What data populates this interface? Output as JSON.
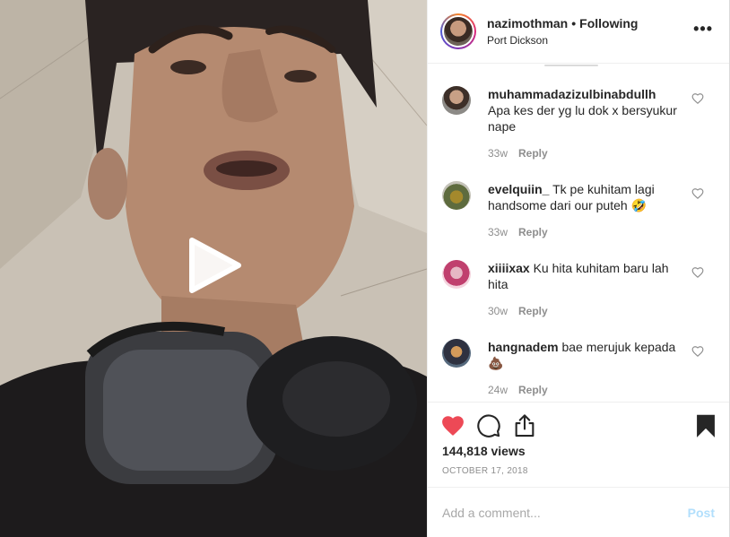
{
  "post": {
    "username": "nazimothman",
    "separator": "•",
    "follow_status": "Following",
    "location": "Port Dickson",
    "more_icon": "more-dots-icon",
    "more_label": "•••"
  },
  "media": {
    "type": "video",
    "play_icon": "play-icon"
  },
  "comments": [
    {
      "username": "muhammadazizulbinabdullh",
      "text": "Apa kes der yg lu dok x bersyukur nape",
      "age": "33w",
      "reply_label": "Reply",
      "avatar_color": "#6b5a4a"
    },
    {
      "username": "evelquiin_",
      "text": "Tk pe kuhitam lagi handsome dari our puteh 🤣",
      "age": "33w",
      "reply_label": "Reply",
      "avatar_color": "#7a6a3a"
    },
    {
      "username": "xiiiixax",
      "text": "Ku hita kuhitam baru lah hita",
      "age": "30w",
      "reply_label": "Reply",
      "avatar_color": "#c46a8a"
    },
    {
      "username": "hangnadem",
      "text": "bae merujuk kepada💩",
      "age": "24w",
      "reply_label": "Reply",
      "avatar_color": "#3a3f52"
    }
  ],
  "actions": {
    "like_icon": "heart-filled-icon",
    "comment_icon": "comment-icon",
    "share_icon": "share-icon",
    "save_icon": "bookmark-filled-icon",
    "like_color": "#ed4956"
  },
  "views": "144,818 views",
  "date": "OCTOBER 17, 2018",
  "add_comment": {
    "placeholder": "Add a comment...",
    "post_label": "Post"
  }
}
